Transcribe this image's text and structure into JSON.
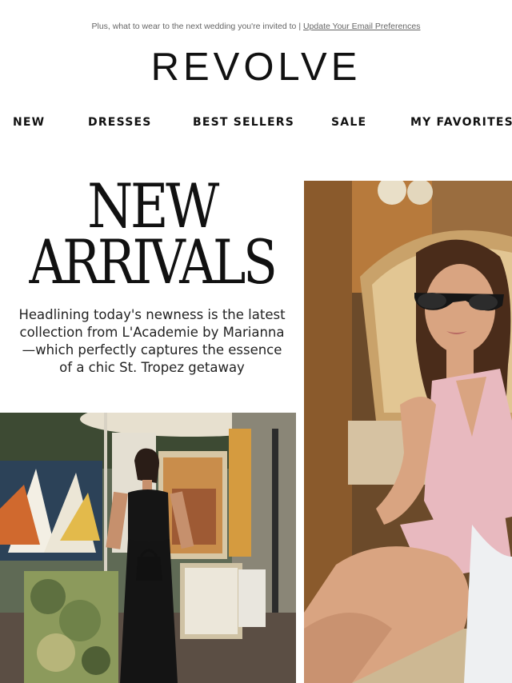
{
  "preheader": {
    "text": "Plus, what to wear to the next wedding you're invited to | ",
    "link": "Update Your Email Preferences"
  },
  "brand": {
    "logo": "REVOLVE"
  },
  "nav": {
    "items": [
      "NEW",
      "DRESSES",
      "BEST SELLERS",
      "SALE",
      "MY FAVORITES"
    ]
  },
  "hero": {
    "title_line1": "NEW",
    "title_line2": "ARRIVALS",
    "body": "Headlining today's newness is the latest collection from L'Academie by Marianna—which perfectly captures the essence of a chic St. Tropez getaway"
  },
  "colors": {
    "text": "#111111",
    "preheader": "#666666",
    "dress_pink": "#e8b9bf",
    "dress_black": "#141414"
  }
}
